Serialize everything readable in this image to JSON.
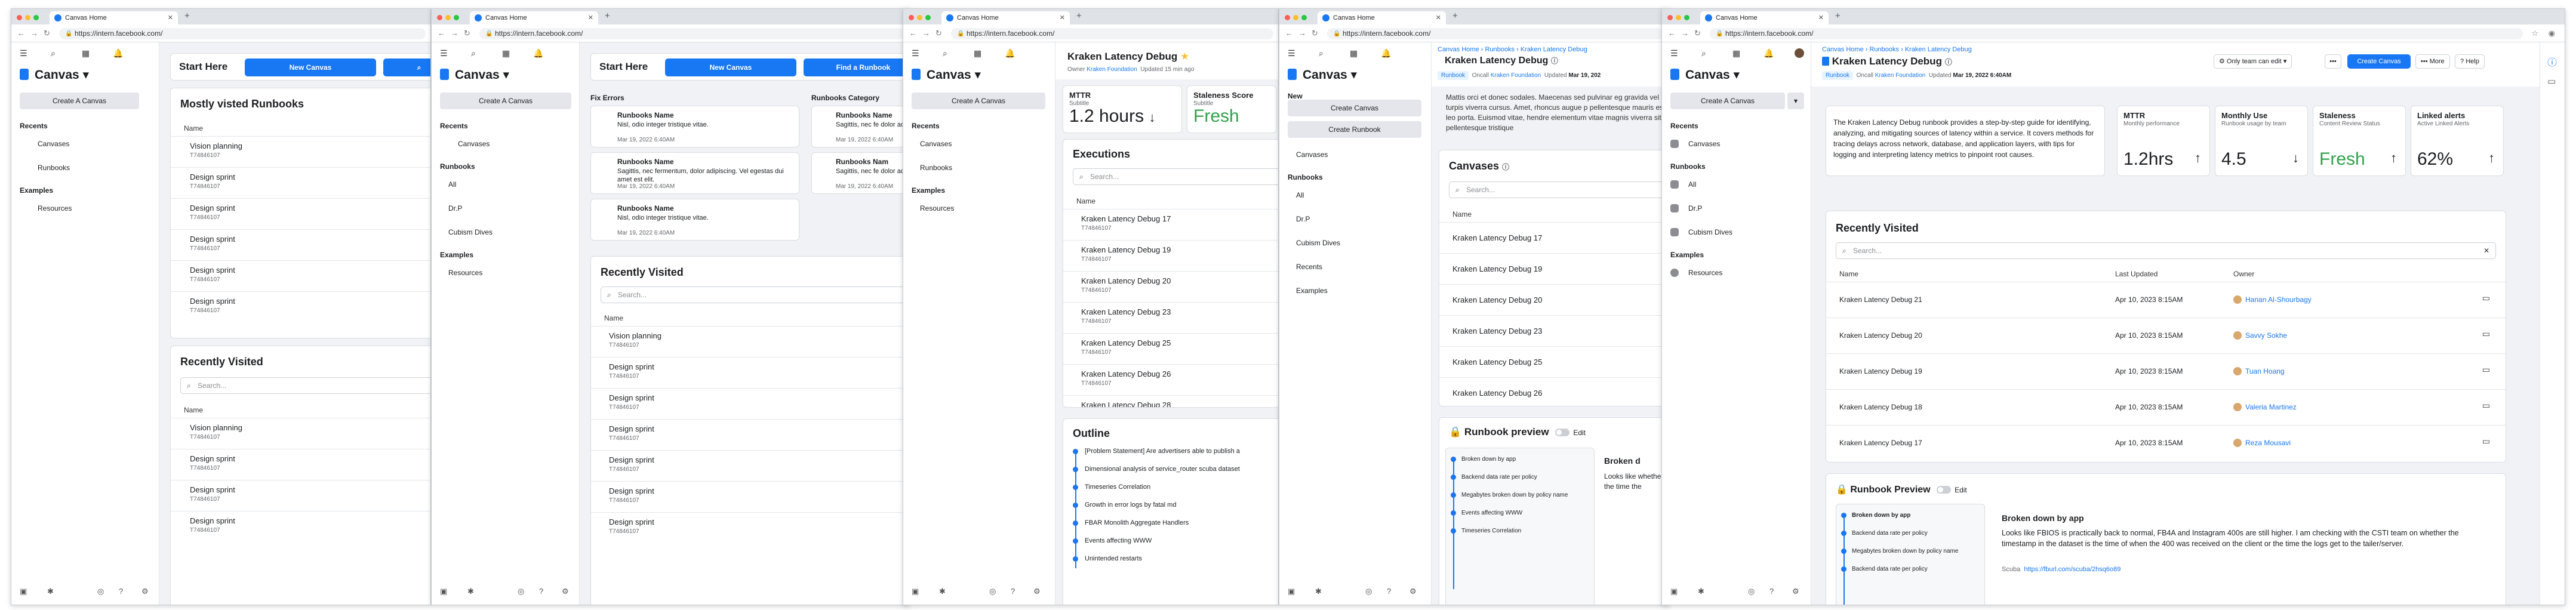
{
  "browser": {
    "tab_title": "Canvas Home",
    "url": "https://intern.facebook.com/"
  },
  "sidebar": {
    "brand": "Canvas",
    "create_label": "Create A Canvas",
    "recents_label": "Recents",
    "examples_label": "Examples",
    "runbooks_label": "Runbooks",
    "new_label": "New",
    "canvases": "Canvases",
    "runbooks": "Runbooks",
    "resources": "Resources",
    "runbook_items": [
      "All",
      "Dr.P",
      "Cubism Dives"
    ],
    "create_canvas_btn": "Create Canvas",
    "create_runbook_btn": "Create Runbook",
    "recents": "Recents",
    "examples": "Examples"
  },
  "p1": {
    "start_here": "Start Here",
    "new_canvas": "New Canvas",
    "most_visited": "Mostly visted Runbooks",
    "name_col": "Name",
    "recently_visited": "Recently Visited",
    "search_placeholder": "Search...",
    "rows_top": [
      {
        "name": "Vision planning",
        "id": "T74846107"
      },
      {
        "name": "Design sprint",
        "id": "T74846107"
      },
      {
        "name": "Design sprint",
        "id": "T74846107"
      },
      {
        "name": "Design sprint",
        "id": "T74846107"
      },
      {
        "name": "Design sprint",
        "id": "T74846107"
      },
      {
        "name": "Design sprint",
        "id": "T74846107"
      }
    ],
    "rows_bottom": [
      {
        "name": "Vision planning",
        "id": "T74846107"
      },
      {
        "name": "Design sprint",
        "id": "T74846107"
      },
      {
        "name": "Design sprint",
        "id": "T74846107"
      },
      {
        "name": "Design sprint",
        "id": "T74846107"
      }
    ]
  },
  "p2": {
    "start_here": "Start Here",
    "new_canvas": "New Canvas",
    "find_runbook": "Find a Runbook",
    "fix_errors": "Fix Errors",
    "runbooks_category": "Runbooks Category",
    "errors": [
      {
        "name": "Runbooks Name",
        "desc": "Nisl, odio integer tristique vitae.",
        "date": "Mar 19, 2022 6:40AM"
      },
      {
        "name": "Runbooks Name",
        "desc": "Sagittis, nec fermentum, dolor adipiscing. Vel egestas dui amet est elit.",
        "date": "Mar 19, 2022 6:40AM"
      },
      {
        "name": "Runbooks Name",
        "desc": "Nisl, odio integer tristique vitae.",
        "date": "Mar 19, 2022 6:40AM"
      }
    ],
    "categories": [
      {
        "name": "Runbooks Name",
        "desc": "Sagittis, nec fe dolor adipiscin",
        "date": "Mar 19, 2022 6:40AM"
      },
      {
        "name": "Runbooks Nam",
        "desc": "Sagittis, nec fe dolor adipiscin",
        "date": "Mar 19, 2022 6:40AM"
      }
    ],
    "recently_visited": "Recently Visited",
    "search_placeholder": "Search...",
    "name_col": "Name",
    "rows": [
      {
        "name": "Vision planning",
        "id": "T74846107"
      },
      {
        "name": "Design sprint",
        "id": "T74846107"
      },
      {
        "name": "Design sprint",
        "id": "T74846107"
      },
      {
        "name": "Design sprint",
        "id": "T74846107"
      },
      {
        "name": "Design sprint",
        "id": "T74846107"
      },
      {
        "name": "Design sprint",
        "id": "T74846107"
      },
      {
        "name": "Design sprint",
        "id": "T74846107"
      }
    ]
  },
  "p3": {
    "title": "Kraken Latency Debug",
    "owner_label": "Owner",
    "owner": "Kraken Foundation",
    "updated": "Updated 15 min ago",
    "mttr_label": "MTTR",
    "mttr_sub": "Subtitle",
    "mttr_value": "1.2 hours",
    "stale_label": "Staleness Score",
    "stale_sub": "Subtitle",
    "stale_value": "Fresh",
    "executions": "Executions",
    "search_placeholder": "Search...",
    "name_col": "Name",
    "exec_rows": [
      {
        "name": "Kraken Latency Debug 17",
        "id": "T74846107"
      },
      {
        "name": "Kraken Latency Debug 19",
        "id": "T74846107"
      },
      {
        "name": "Kraken Latency Debug 20",
        "id": "T74846107"
      },
      {
        "name": "Kraken Latency Debug 23",
        "id": "T74846107"
      },
      {
        "name": "Kraken Latency Debug 25",
        "id": "T74846107"
      },
      {
        "name": "Kraken Latency Debug 26",
        "id": "T74846107"
      },
      {
        "name": "Kraken Latency Debug 28",
        "id": ""
      }
    ],
    "outline": "Outline",
    "outline_items": [
      "[Problem Statement] Are advertisers able to publish a",
      "Dimensional analysis of service_router scuba dataset",
      "Timeseries Correlation",
      "Growth in error logs by fatal md",
      "FBAR Monolith Aggregate Handlers",
      "Events affecting WWW",
      "Unintended restarts"
    ]
  },
  "p4": {
    "crumbs": [
      "Canvas Home",
      "Runbooks",
      "Kraken Latency Debug"
    ],
    "title": "Kraken Latency Debug",
    "runbook_tag": "Runbook",
    "oncall_label": "Oncall",
    "oncall": "Kraken Foundation",
    "updated_label": "Updated",
    "updated": "Mar 19, 202",
    "desc": "Mattis orci et donec sodales. Maecenas sed pulvinar eg gravida vel turpis viverra cursus. Amet, rhoncus augue p pellentesque mauris est leo porta. Euismod vitae, hendre elementum vitae magnis viverra sit pellentesque tristique",
    "canvases": "Canvases",
    "search_placeholder": "Search...",
    "name_col": "Name",
    "rows": [
      "Kraken Latency Debug 17",
      "Kraken Latency Debug 19",
      "Kraken Latency Debug 20",
      "Kraken Latency Debug 23",
      "Kraken Latency Debug 25",
      "Kraken Latency Debug 26"
    ],
    "preview": "Runbook preview",
    "edit": "Edit",
    "preview_items": [
      "Broken down by app",
      "Backend data rate per policy",
      "Megabytes broken down by policy name",
      "Events affecting WWW",
      "Timeseries Correlation"
    ],
    "preview_right_title": "Broken d",
    "preview_right_text": "Looks like whether the time the"
  },
  "p5": {
    "crumbs": [
      "Canvas Home",
      "Runbooks",
      "Kraken Latency Debug"
    ],
    "title": "Kraken Latency Debug",
    "runbook_tag": "Runbook",
    "oncall_label": "Oncall",
    "oncall": "Kraken Foundation",
    "updated_label": "Updated",
    "updated": "Mar 19, 2022 6:40AM",
    "share": "Only team can edit",
    "create_canvas": "Create Canvas",
    "more": "More",
    "help": "Help",
    "desc": "The Kraken Latency Debug runbook provides a step-by-step guide for identifying, analyzing, and mitigating sources of latency within a service. It covers methods for tracing delays across network, database, and application layers, with tips for logging and interpreting latency metrics to pinpoint root causes.",
    "stats": [
      {
        "title": "MTTR",
        "sub": "Monthly performance",
        "value": "1.2hrs",
        "arrow": "↑",
        "color": "#1c1e21"
      },
      {
        "title": "Monthly Use",
        "sub": "Runbook usage by team",
        "value": "4.5",
        "arrow": "↓",
        "color": "#1c1e21"
      },
      {
        "title": "Staleness",
        "sub": "Content Review Status",
        "value": "Fresh",
        "arrow": "↑",
        "color": "#31a24c"
      },
      {
        "title": "Linked alerts",
        "sub": "Active Linked Alerts",
        "value": "62%",
        "arrow": "↑",
        "color": "#1c1e21"
      }
    ],
    "recently_visited": "Recently Visited",
    "search_placeholder": "Search...",
    "cols": {
      "name": "Name",
      "last": "Last Updated",
      "owner": "Owner"
    },
    "rows": [
      {
        "name": "Kraken Latency Debug 21",
        "date": "Apr 10, 2023 8:15AM",
        "owner": "Hanan Al-Shourbagy"
      },
      {
        "name": "Kraken Latency Debug 20",
        "date": "Apr 10, 2023 8:15AM",
        "owner": "Savvy Sokhe"
      },
      {
        "name": "Kraken Latency Debug 19",
        "date": "Apr 10, 2023 8:15AM",
        "owner": "Tuan Hoang"
      },
      {
        "name": "Kraken Latency Debug 18",
        "date": "Apr 10, 2023 8:15AM",
        "owner": "Valeria Martinez"
      },
      {
        "name": "Kraken Latency Debug 17",
        "date": "Apr 10, 2023 8:15AM",
        "owner": "Reza Mousavi"
      }
    ],
    "preview": "Runbook Preview",
    "edit": "Edit",
    "preview_items": [
      "Broken down by app",
      "Backend data rate per policy",
      "Megabytes broken down by policy name",
      "Backend data rate per policy"
    ],
    "preview_title": "Broken down by app",
    "preview_text": "Looks like FBIOS is practically back to normal, FB4A and Instagram 400s are still higher. I am checking with the CSTI team on whether the timestamp in the dataset is the time of when the 400 was received on the client or the time the logs get to the tailer/server.",
    "preview_link_label": "Scuba",
    "preview_link": "https://fburl.com/scuba/2hsq6o89"
  }
}
